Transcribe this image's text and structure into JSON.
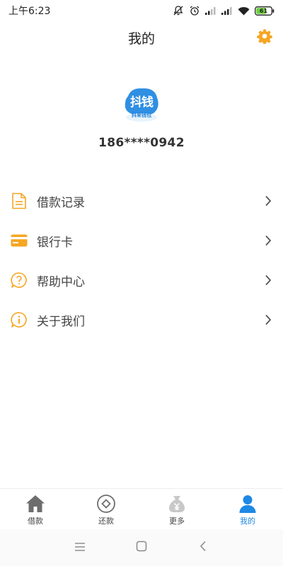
{
  "status_bar": {
    "time": "上午6:23",
    "battery": "61"
  },
  "header": {
    "title": "我的"
  },
  "profile": {
    "logo_main": "抖钱",
    "logo_sub": "抖来钱包",
    "phone": "186****0942"
  },
  "menu": [
    {
      "label": "借款记录",
      "icon": "document-icon"
    },
    {
      "label": "银行卡",
      "icon": "card-icon"
    },
    {
      "label": "帮助中心",
      "icon": "help-icon"
    },
    {
      "label": "关于我们",
      "icon": "info-icon"
    }
  ],
  "tabs": [
    {
      "label": "借款",
      "icon": "home-icon"
    },
    {
      "label": "还款",
      "icon": "repay-icon"
    },
    {
      "label": "更多",
      "icon": "money-bag-icon"
    },
    {
      "label": "我的",
      "icon": "person-icon",
      "active": true
    }
  ],
  "colors": {
    "accent_orange": "#f5a623",
    "active_blue": "#1e88e5",
    "logo_blue": "#2f8fe3"
  }
}
